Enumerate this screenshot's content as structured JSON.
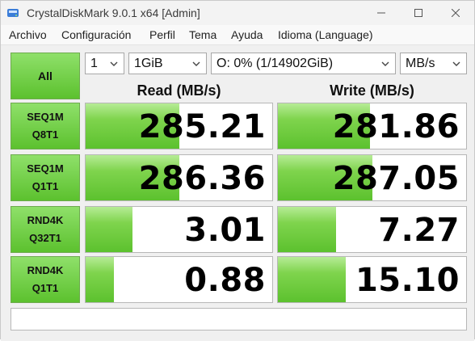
{
  "window": {
    "title": "CrystalDiskMark 9.0.1 x64 [Admin]"
  },
  "menu": [
    "Archivo",
    "Configuración",
    "Perfil",
    "Tema",
    "Ayuda",
    "Idioma (Language)"
  ],
  "toolbar": {
    "all_label": "All",
    "count": "1",
    "size": "1GiB",
    "drive": "O: 0% (1/14902GiB)",
    "unit": "MB/s"
  },
  "headers": {
    "read": "Read (MB/s)",
    "write": "Write (MB/s)"
  },
  "rows": [
    {
      "line1": "SEQ1M",
      "line2": "Q8T1",
      "read": "285.21",
      "write": "281.86",
      "read_fill": 0.5,
      "write_fill": 0.49
    },
    {
      "line1": "SEQ1M",
      "line2": "Q1T1",
      "read": "286.36",
      "write": "287.05",
      "read_fill": 0.5,
      "write_fill": 0.5
    },
    {
      "line1": "RND4K",
      "line2": "Q32T1",
      "read": "3.01",
      "write": "7.27",
      "read_fill": 0.25,
      "write_fill": 0.31
    },
    {
      "line1": "RND4K",
      "line2": "Q1T1",
      "read": "0.88",
      "write": "15.10",
      "read_fill": 0.15,
      "write_fill": 0.36
    }
  ],
  "status_text": "",
  "colors": {
    "accent_green": "#5cc12e",
    "border_green": "#6eaa4f"
  }
}
